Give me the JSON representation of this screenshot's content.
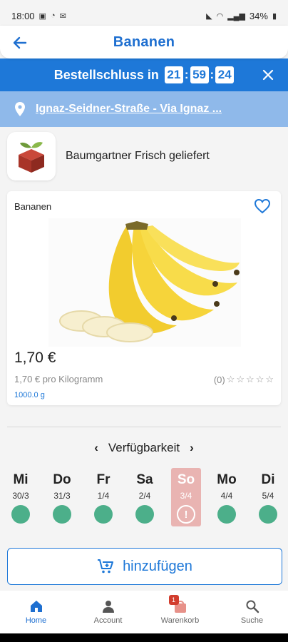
{
  "status_bar": {
    "time": "18:00",
    "battery": "34%"
  },
  "header": {
    "title": "Bananen"
  },
  "deadline": {
    "label": "Bestellschluss in",
    "hours": "21",
    "minutes": "59",
    "seconds": "24"
  },
  "address": {
    "text": "Ignaz-Seidner-Straße - Via Ignaz ..."
  },
  "vendor": {
    "name": "Baumgartner Frisch geliefert"
  },
  "product": {
    "name": "Bananen",
    "price": "1,70 €",
    "unit_price": "1,70 € pro Kilogramm",
    "rating_count": "(0)",
    "rating": 0,
    "weight": "1000.0 g"
  },
  "availability": {
    "title": "Verfügbarkeit",
    "days": [
      {
        "name": "Mi",
        "date": "30/3",
        "available": true
      },
      {
        "name": "Do",
        "date": "31/3",
        "available": true
      },
      {
        "name": "Fr",
        "date": "1/4",
        "available": true
      },
      {
        "name": "Sa",
        "date": "2/4",
        "available": true
      },
      {
        "name": "So",
        "date": "3/4",
        "available": false
      },
      {
        "name": "Mo",
        "date": "4/4",
        "available": true
      },
      {
        "name": "Di",
        "date": "5/4",
        "available": true
      }
    ]
  },
  "add_button": {
    "label": "hinzufügen"
  },
  "nav": {
    "home": "Home",
    "account": "Account",
    "cart": "Warenkorb",
    "cart_badge": "1",
    "search": "Suche"
  },
  "colors": {
    "primary": "#1e78d8",
    "available": "#4caf8a",
    "closed": "#e9b4b2"
  }
}
